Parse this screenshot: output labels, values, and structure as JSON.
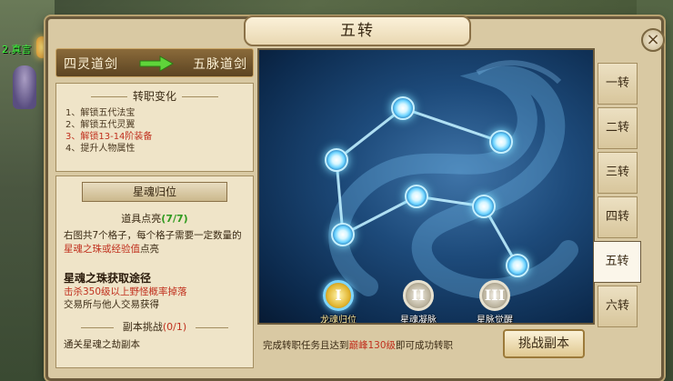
{
  "window": {
    "title": "五转",
    "close": "×"
  },
  "background": {
    "npc_name": "2.真言"
  },
  "conversion": {
    "from": "四灵道剑",
    "to": "五脉道剑"
  },
  "changes": {
    "heading": "转职变化",
    "items": [
      {
        "text": "1、解锁五代法宝",
        "highlight": false
      },
      {
        "text": "2、解锁五代灵翼",
        "highlight": false
      },
      {
        "text": "3、解锁13-14阶装备",
        "highlight": true
      },
      {
        "text": "4、提升人物属性",
        "highlight": false
      }
    ]
  },
  "star_soul": {
    "heading": "星魂归位",
    "light_label": "道具点亮",
    "light_count": "(7/7)",
    "desc_1": "右图共7个格子，每个格子需要一定数量的",
    "desc_red": "星魂之珠或经验值",
    "desc_2": "点亮",
    "path_title": "星魂之珠获取途径",
    "path_1": "击杀350级以上野怪概率掉落",
    "path_2": "交易所与他人交易获得"
  },
  "challenge": {
    "heading": "副本挑战",
    "count": "(0/1)",
    "desc": "通关星魂之劫副本"
  },
  "stages": [
    {
      "numeral": "I",
      "label": "龙魂归位",
      "active": true
    },
    {
      "numeral": "II",
      "label": "星魂凝脉",
      "active": false
    },
    {
      "numeral": "III",
      "label": "星脉觉醒",
      "active": false
    }
  ],
  "bottom": {
    "text_1": "完成转职任务且达到",
    "text_red": "巅峰130级",
    "text_2": "即可成功转职",
    "button": "挑战副本"
  },
  "tabs": [
    {
      "label": "一转",
      "active": false
    },
    {
      "label": "二转",
      "active": false
    },
    {
      "label": "三转",
      "active": false
    },
    {
      "label": "四转",
      "active": false
    },
    {
      "label": "五转",
      "active": true
    },
    {
      "label": "六转",
      "active": false
    }
  ],
  "colors": {
    "accent_red": "#c0301e",
    "accent_green": "#2f9a1f",
    "star_glow": "#7fe0ff"
  },
  "icons": {
    "arrow": "green-right-arrow-icon",
    "close": "close-icon",
    "nodes": "star-node-icon"
  }
}
